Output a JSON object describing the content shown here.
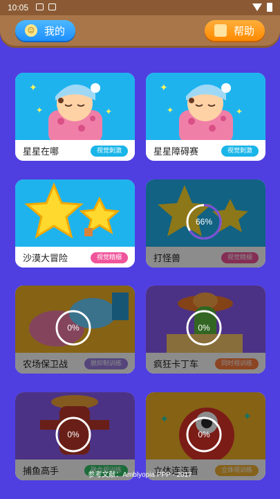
{
  "status_bar": {
    "time": "10:05"
  },
  "header": {
    "me_label": "我的",
    "help_label": "帮助"
  },
  "games": [
    {
      "title": "星星在哪",
      "badge": "视觉刺激",
      "badge_color": "#19b5e8",
      "locked": false
    },
    {
      "title": "星星障碍赛",
      "badge": "视觉刺激",
      "badge_color": "#19b5e8",
      "locked": false
    },
    {
      "title": "沙漠大冒险",
      "badge": "视觉精细",
      "badge_color": "#f0559b",
      "locked": false
    },
    {
      "title": "打怪兽",
      "badge": "视觉精细",
      "badge_color": "#f0559b",
      "locked": true,
      "progress_text": "66%",
      "progress": 0.66
    },
    {
      "title": "农场保卫战",
      "badge": "脱抑制训练",
      "badge_color": "#9b7fe0",
      "locked": true,
      "progress_text": "0%",
      "progress": 0
    },
    {
      "title": "疯狂卡丁车",
      "badge": "同时视训练",
      "badge_color": "#ff7f3f",
      "locked": true,
      "progress_text": "0%",
      "progress": 0
    },
    {
      "title": "捕鱼高手",
      "badge": "融合视训练",
      "badge_color": "#35c46b",
      "locked": true,
      "progress_text": "0%",
      "progress": 0
    },
    {
      "title": "立体连连看",
      "badge": "立体视训练",
      "badge_color": "#f2b233",
      "locked": true,
      "progress_text": "0%",
      "progress": 0
    }
  ],
  "footer": {
    "reference": "参考文献：Amblyopia PPP - 2017"
  }
}
